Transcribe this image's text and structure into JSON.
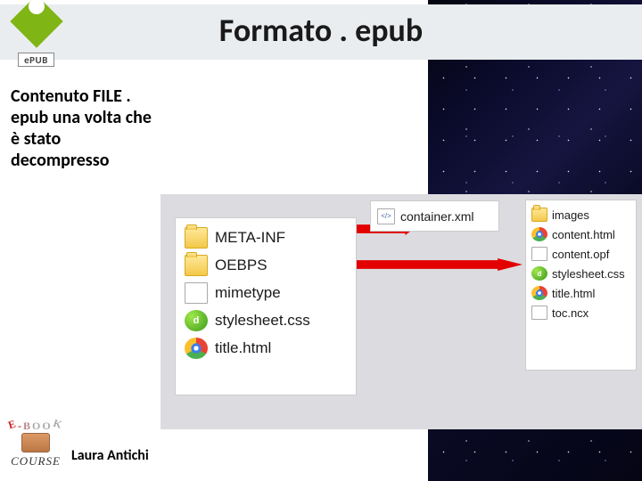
{
  "header": {
    "logo_text": "ePUB",
    "title": "Formato . epub"
  },
  "body": {
    "description": "Contenuto FILE . epub una volta che è stato decompresso"
  },
  "file_groups": {
    "root": [
      {
        "icon": "folder",
        "label": "META-INF"
      },
      {
        "icon": "folder",
        "label": "OEBPS"
      },
      {
        "icon": "file",
        "label": "mimetype"
      },
      {
        "icon": "dw",
        "label": "stylesheet.css"
      },
      {
        "icon": "chrome",
        "label": "title.html"
      }
    ],
    "meta_inf": [
      {
        "icon": "file-code",
        "label": "container.xml"
      }
    ],
    "oebps": [
      {
        "icon": "folder",
        "label": "images"
      },
      {
        "icon": "chrome",
        "label": "content.html"
      },
      {
        "icon": "file",
        "label": "content.opf"
      },
      {
        "icon": "dw",
        "label": "stylesheet.css"
      },
      {
        "icon": "chrome",
        "label": "title.html"
      },
      {
        "icon": "file",
        "label": "toc.ncx"
      }
    ]
  },
  "footer": {
    "course_arc": "E-BOOK",
    "course_label": "COURSE",
    "author": "Laura Antichi"
  }
}
